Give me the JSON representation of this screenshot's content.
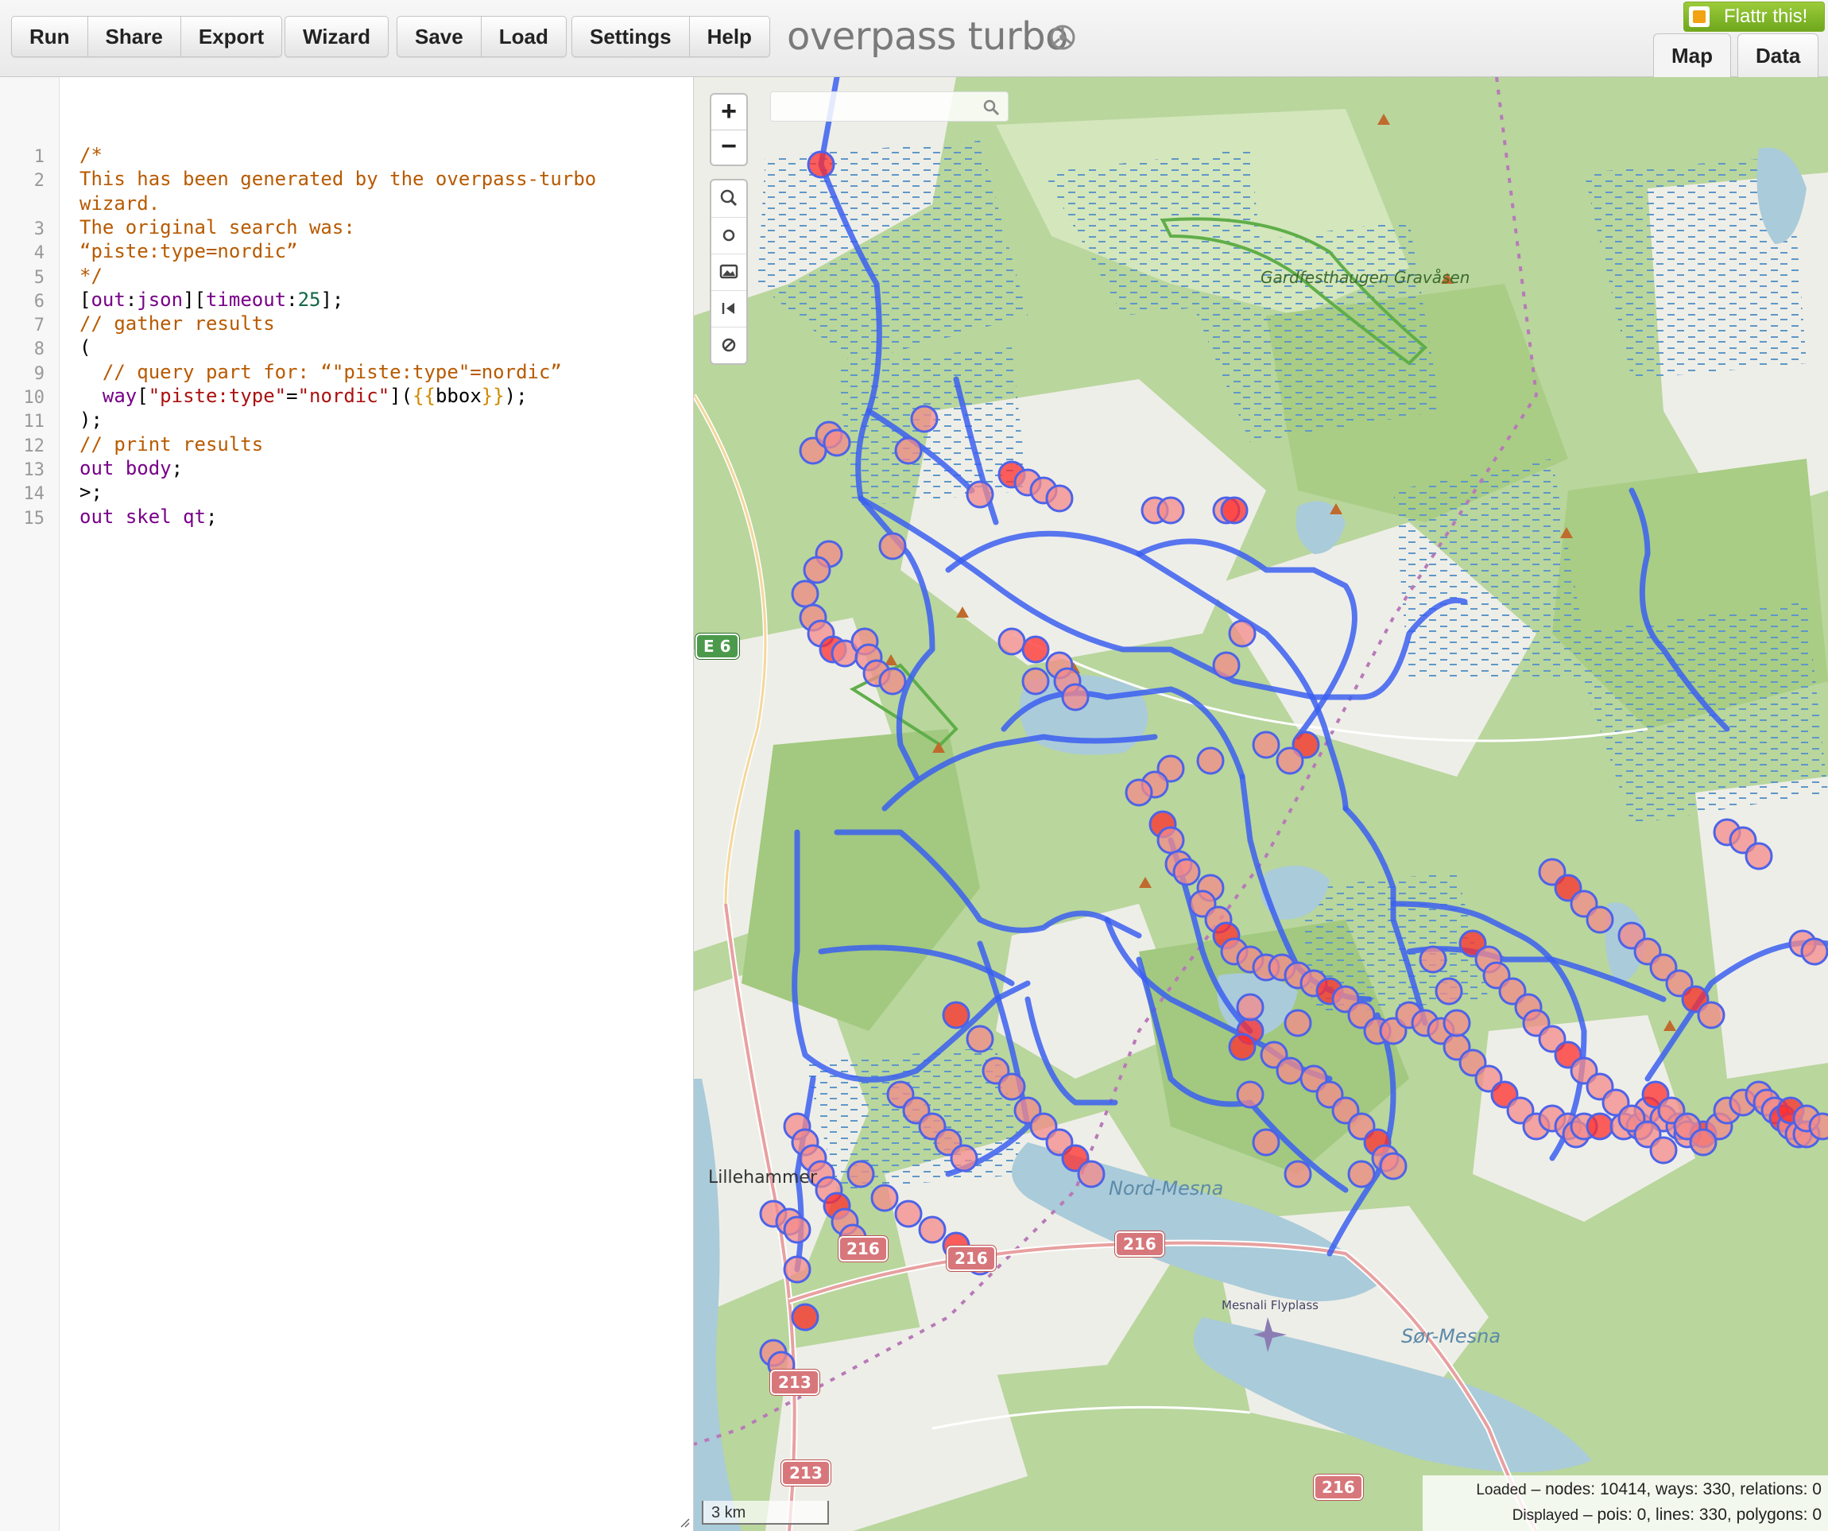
{
  "toolbar": {
    "group1": [
      "Run",
      "Share",
      "Export"
    ],
    "group2": [
      "Wizard"
    ],
    "group3": [
      "Save",
      "Load"
    ],
    "group4": [
      "Settings",
      "Help"
    ],
    "app_title": "overpass turbo",
    "flattr_label": "Flattr this!",
    "tabs": {
      "map": "Map",
      "data": "Data"
    }
  },
  "editor": {
    "line_numbers": [
      "1",
      "2",
      "",
      "3",
      "4",
      "5",
      "6",
      "7",
      "8",
      "9",
      "10",
      "11",
      "12",
      "13",
      "14",
      "15"
    ],
    "lines": [
      "/*",
      "This has been generated by the overpass-turbo",
      "wizard.",
      "The original search was:",
      "“piste:type=nordic”",
      "*/",
      "[out:json][timeout:25];",
      "// gather results",
      "(",
      "  // query part for: “\"piste:type\"=nordic”",
      "  way[\"piste:type\"=\"nordic\"]({{bbox}});",
      ");",
      "// print results",
      "out body;",
      ">;",
      "out skel qt;"
    ]
  },
  "map": {
    "zoom_in": "+",
    "zoom_out": "−",
    "search_placeholder": "",
    "tools": [
      "search-icon",
      "circle-icon",
      "image-icon",
      "previous-icon",
      "clear-icon"
    ],
    "labels": {
      "area": "Gardfesthaugen Gravåsen",
      "lake1": "Nord-Mesna",
      "lake2": "Sør-Mesna",
      "town": "Lillehammer",
      "airport": "Mesnali Flyplass"
    },
    "road_shields": [
      "E 6",
      "216",
      "216",
      "216",
      "213",
      "213",
      "216"
    ],
    "scale": "3 km",
    "stats": {
      "loaded_label": "Loaded",
      "loaded": "– nodes: 10414, ways: 330, relations: 0",
      "displayed_label": "Displayed",
      "displayed": "– pois: 0, lines: 330, polygons: 0"
    },
    "colors": {
      "route": "#3b5ff0",
      "node_fill": "#f48a8a",
      "node_stroke": "#4d63e8",
      "node_dense": "#ff2c2c",
      "forest": "#a7cc84",
      "open": "#f0efe9",
      "water": "#aacbd9"
    }
  }
}
